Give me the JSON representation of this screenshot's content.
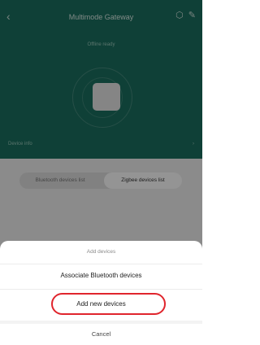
{
  "header": {
    "title": "Multimode Gateway",
    "status": "Offline ready",
    "info_label": "Device info",
    "icons": [
      "back-icon",
      "gateway-icon",
      "edit-icon"
    ]
  },
  "tabs": [
    {
      "label": "Bluetooth devices list",
      "selected": false
    },
    {
      "label": "Zigbee devices list",
      "selected": true
    }
  ],
  "sheet": {
    "title": "Add devices",
    "items": [
      {
        "label": "Associate Bluetooth devices"
      },
      {
        "label": "Add new devices",
        "highlighted": true
      }
    ],
    "cancel_label": "Cancel"
  },
  "colors": {
    "header_bg": "#1b6f5f",
    "highlight": "#e0252d",
    "overlay": "rgba(0,0,0,0.42)"
  }
}
